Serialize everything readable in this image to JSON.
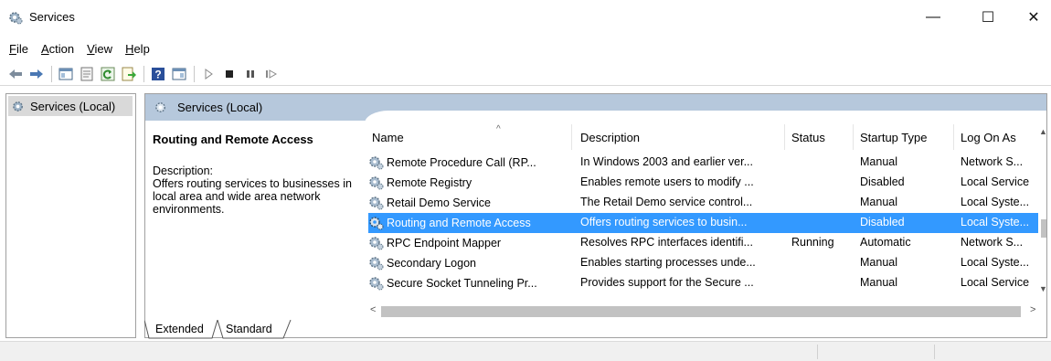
{
  "window": {
    "title": "Services",
    "icon": "services-gear-icon"
  },
  "window_controls": {
    "minimize": "—",
    "maximize": "☐",
    "close": "✕"
  },
  "menu": [
    {
      "key": "F",
      "rest": "ile"
    },
    {
      "key": "A",
      "rest": "ction"
    },
    {
      "key": "V",
      "rest": "iew"
    },
    {
      "key": "H",
      "rest": "elp"
    }
  ],
  "toolbar": {
    "icons": [
      "back-arrow-icon",
      "forward-arrow-icon",
      "show-hide-console-tree-icon",
      "properties-icon",
      "refresh-icon",
      "export-list-icon",
      "help-icon",
      "show-action-pane-icon",
      "start-service-icon",
      "stop-service-icon",
      "pause-service-icon",
      "resume-service-icon"
    ]
  },
  "tree": {
    "root_label": "Services (Local)"
  },
  "header": {
    "title": "Services (Local)"
  },
  "details": {
    "service_name": "Routing and Remote Access",
    "label": "Description:",
    "text": "Offers routing services to businesses in local area and wide area network environments."
  },
  "columns": [
    "Name",
    "Description",
    "Status",
    "Startup Type",
    "Log On As"
  ],
  "services": [
    {
      "name": "Remote Procedure Call (RP...",
      "description": "In Windows 2003 and earlier ver...",
      "status": "",
      "startup": "Manual",
      "logon": "Network S..."
    },
    {
      "name": "Remote Registry",
      "description": "Enables remote users to modify ...",
      "status": "",
      "startup": "Disabled",
      "logon": "Local Service"
    },
    {
      "name": "Retail Demo Service",
      "description": "The Retail Demo service control...",
      "status": "",
      "startup": "Manual",
      "logon": "Local Syste..."
    },
    {
      "name": "Routing and Remote Access",
      "description": "Offers routing services to busin...",
      "status": "",
      "startup": "Disabled",
      "logon": "Local Syste...",
      "selected": true
    },
    {
      "name": "RPC Endpoint Mapper",
      "description": "Resolves RPC interfaces identifi...",
      "status": "Running",
      "startup": "Automatic",
      "logon": "Network S..."
    },
    {
      "name": "Secondary Logon",
      "description": "Enables starting processes unde...",
      "status": "",
      "startup": "Manual",
      "logon": "Local Syste..."
    },
    {
      "name": "Secure Socket Tunneling Pr...",
      "description": "Provides support for the Secure ...",
      "status": "",
      "startup": "Manual",
      "logon": "Local Service"
    }
  ],
  "tabs": [
    "Extended",
    "Standard"
  ],
  "colors": {
    "selection": "#3399ff",
    "header_band": "#b6c8dc",
    "tree_selected": "#d9d9d9"
  }
}
